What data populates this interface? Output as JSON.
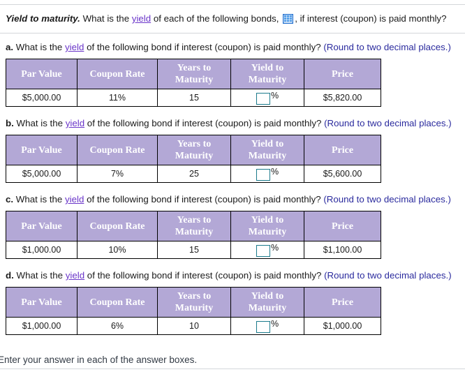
{
  "page": {
    "top_divider": true,
    "bottom_divider": true,
    "footer_note": "Enter your answer in each of the answer boxes."
  },
  "header": {
    "title": "Yield to maturity.",
    "text_before_link": " What is the ",
    "link_label": "yield",
    "text_after_link": " of each of the following bonds, ",
    "icon": "spreadsheet-grid-icon",
    "text_end": ", if interest (coupon) is paid monthly?"
  },
  "common": {
    "prompt_before_link": "What is the ",
    "prompt_link": "yield",
    "prompt_after_link": " of the following bond if interest (coupon) is paid monthly? ",
    "round_note": "(Round to two decimal places.)",
    "percent_symbol": "%",
    "input_placeholder": "",
    "input_value": ""
  },
  "table_headers": {
    "par_value": "Par Value",
    "coupon_rate": "Coupon Rate",
    "years_to_maturity_line1": "Years to",
    "years_to_maturity_line2": "Maturity",
    "yield_to_maturity_line1": "Yield to",
    "yield_to_maturity_line2": "Maturity",
    "price": "Price"
  },
  "colors": {
    "header_bg": "#b3a8d6",
    "header_text": "#ffffff",
    "link": "#6a35c9",
    "round_note": "#2b2b9e",
    "input_border": "#1b7a8c",
    "table_border": "#000000",
    "divider": "#d3d6da",
    "icon_blue": "#1f6fd0"
  },
  "parts": [
    {
      "letter": "a.",
      "par_value": "$5,000.00",
      "coupon_rate": "11%",
      "years_to_maturity": "15",
      "yield_to_maturity": "",
      "price": "$5,820.00"
    },
    {
      "letter": "b.",
      "par_value": "$5,000.00",
      "coupon_rate": "7%",
      "years_to_maturity": "25",
      "yield_to_maturity": "",
      "price": "$5,600.00"
    },
    {
      "letter": "c.",
      "par_value": "$1,000.00",
      "coupon_rate": "10%",
      "years_to_maturity": "15",
      "yield_to_maturity": "",
      "price": "$1,100.00"
    },
    {
      "letter": "d.",
      "par_value": "$1,000.00",
      "coupon_rate": "6%",
      "years_to_maturity": "10",
      "yield_to_maturity": "",
      "price": "$1,000.00"
    }
  ]
}
